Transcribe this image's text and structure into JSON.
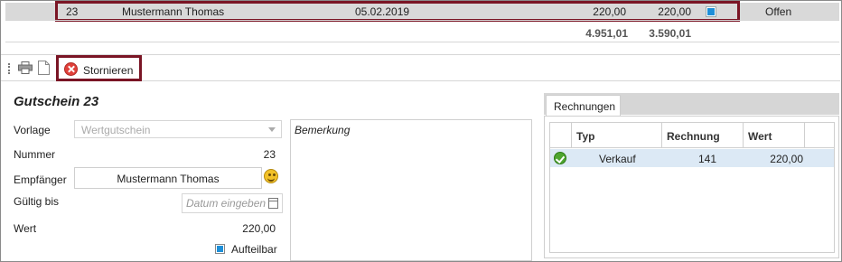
{
  "grid": {
    "selected_row": {
      "nr": "23",
      "name": "Mustermann Thomas",
      "date": "05.02.2019",
      "amount1": "220,00",
      "amount2": "220,00",
      "status": "Offen"
    },
    "totals": {
      "sum1": "4.951,01",
      "sum2": "3.590,01"
    }
  },
  "toolbar": {
    "storno_label": "Stornieren",
    "icons": [
      "print-icon",
      "document-icon",
      "cancel-icon"
    ]
  },
  "form": {
    "title": "Gutschein 23",
    "vorlage_label": "Vorlage",
    "vorlage_value": "Wertgutschein",
    "nummer_label": "Nummer",
    "nummer_value": "23",
    "empfaenger_label": "Empfänger",
    "empfaenger_value": "Mustermann Thomas",
    "gueltig_label": "Gültig bis",
    "gueltig_placeholder": "Datum eingeben",
    "wert_label": "Wert",
    "wert_value": "220,00",
    "aufteilbar_label": "Aufteilbar",
    "aufteilbar_checked": true
  },
  "remark": {
    "placeholder": "Bemerkung"
  },
  "invoices": {
    "tab_label": "Rechnungen",
    "columns": [
      "Typ",
      "Rechnung",
      "Wert"
    ],
    "rows": [
      {
        "typ": "Verkauf",
        "rechnung": "141",
        "wert": "220,00",
        "status_icon": "check-icon"
      }
    ]
  },
  "colors": {
    "highlight_border": "#7a1525",
    "accent_blue": "#1e8fd8",
    "selected_row_bg": "#d9d9d9",
    "table_row_bg": "#dce9f5"
  }
}
